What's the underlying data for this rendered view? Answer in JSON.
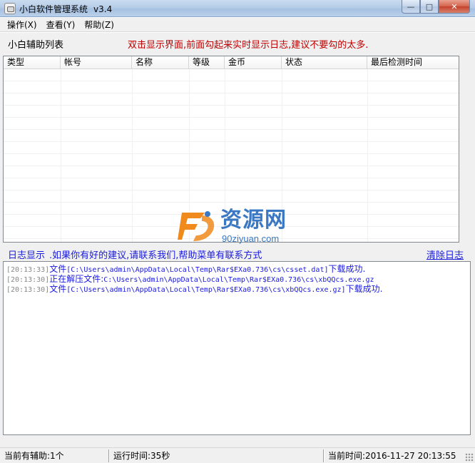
{
  "window": {
    "title": "小白软件管理系统",
    "version": "v3.4",
    "buttons": {
      "minimize": "—",
      "maximize": "□",
      "close": "✕"
    }
  },
  "menu": {
    "items": [
      {
        "label": "操作(X)"
      },
      {
        "label": "查看(Y)"
      },
      {
        "label": "帮助(Z)"
      }
    ]
  },
  "helper_list": {
    "title": "小白辅助列表",
    "hint": "双击显示界面,前面勾起来实时显示日志,建议不要勾的太多.",
    "columns": [
      "类型",
      "帐号",
      "名称",
      "等级",
      "金币",
      "状态",
      "最后检测时间"
    ],
    "rows": []
  },
  "watermark": {
    "text": "资源网",
    "url": "90ziyuan.com"
  },
  "log": {
    "label": "日志显示",
    "hint": ".如果你有好的建议,请联系我们,帮助菜单有联系方式",
    "clear_link": "清除日志",
    "entries": [
      {
        "time": "[20:13:33]",
        "prefix": "文件",
        "path": "[C:\\Users\\admin\\AppData\\Local\\Temp\\Rar$EXa0.736\\cs\\csset.dat]",
        "suffix": "下载成功."
      },
      {
        "time": "[20:13:30]",
        "prefix": "正在解压文件:",
        "path": "C:\\Users\\admin\\AppData\\Local\\Temp\\Rar$EXa0.736\\cs\\xbQQcs.exe.gz",
        "suffix": ""
      },
      {
        "time": "[20:13:30]",
        "prefix": "文件",
        "path": "[C:\\Users\\admin\\AppData\\Local\\Temp\\Rar$EXa0.736\\cs\\xbQQcs.exe.gz]",
        "suffix": "下载成功."
      }
    ]
  },
  "status": {
    "helper_count": "当前有辅助:1个",
    "runtime": "运行时间:35秒",
    "current_time": "当前时间:2016-11-27  20:13:55"
  },
  "colors": {
    "hint_red": "#c00000",
    "link_blue": "#1a1adb",
    "watermark_blue": "#3a78c3",
    "watermark_orange": "#f08a1c"
  }
}
